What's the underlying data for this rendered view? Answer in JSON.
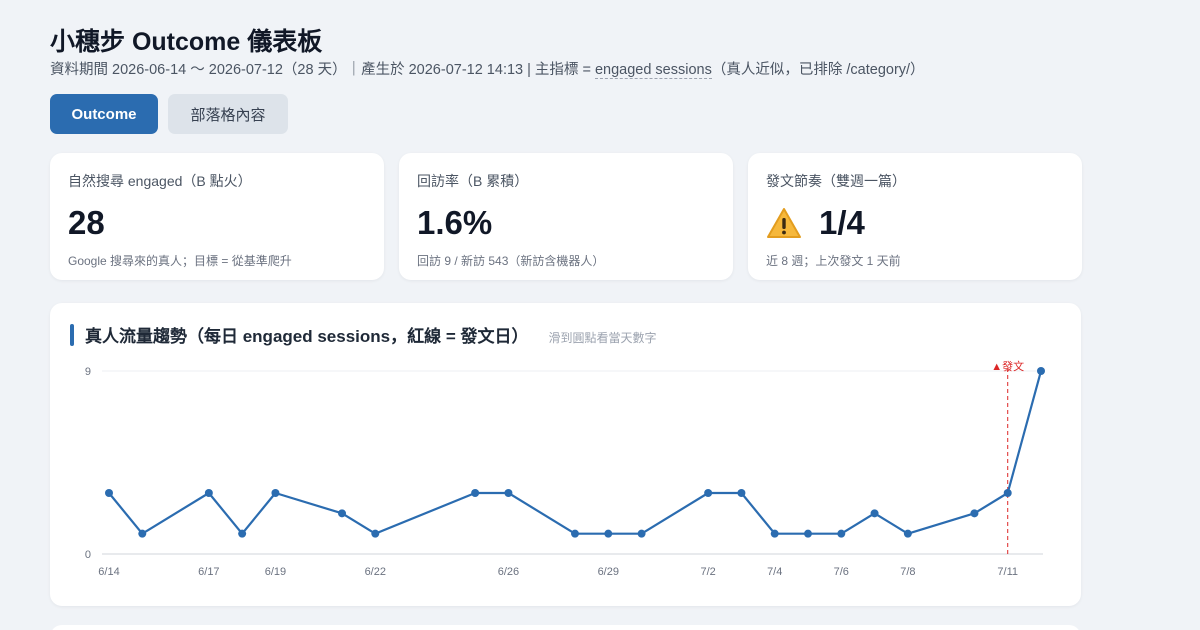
{
  "header": {
    "title": "小穗步 Outcome 儀表板",
    "subtitle_prefix": "資料期間 2026-06-14 ～ 2026-07-12（28 天）｜產生於 2026-07-12 14:13 | 主指標 = ",
    "subtitle_metric": "engaged sessions",
    "subtitle_suffix": "（真人近似，已排除 /category/）"
  },
  "tabs": [
    {
      "label": "Outcome",
      "active": true
    },
    {
      "label": "部落格內容",
      "active": false
    }
  ],
  "kpis": [
    {
      "label": "自然搜尋 engaged（B 點火）",
      "value": "28",
      "note": "Google 搜尋來的真人；目標 = 從基準爬升",
      "icon": null
    },
    {
      "label": "回訪率（B 累積）",
      "value": "1.6%",
      "note": "回訪 9 / 新訪 543（新訪含機器人）",
      "icon": null
    },
    {
      "label": "發文節奏（雙週一篇）",
      "value": "1/4",
      "note": "近 8 週；上次發文 1 天前",
      "icon": "warning-icon"
    }
  ],
  "chart": {
    "title": "真人流量趨勢（每日 engaged sessions，紅線 = 發文日）",
    "hint": "滑到圓點看當天數字"
  },
  "chart_data": {
    "type": "line",
    "title": "真人流量趨勢（每日 engaged sessions，紅線 = 發文日）",
    "x": [
      "6/14",
      "6/15",
      "6/17",
      "6/18",
      "6/19",
      "6/21",
      "6/22",
      "6/25",
      "6/26",
      "6/28",
      "6/29",
      "6/30",
      "7/2",
      "7/3",
      "7/4",
      "7/5",
      "7/6",
      "7/7",
      "7/8",
      "7/10",
      "7/11",
      "7/12"
    ],
    "y": [
      3,
      1,
      3,
      1,
      3,
      2,
      1,
      3,
      3,
      1,
      1,
      1,
      3,
      3,
      1,
      1,
      1,
      2,
      1,
      2,
      3,
      9
    ],
    "tick_labels": [
      "6/14",
      "6/17",
      "6/19",
      "6/22",
      "6/26",
      "6/29",
      "7/2",
      "7/4",
      "7/6",
      "7/8",
      "7/11"
    ],
    "y_ticks": [
      0,
      9
    ],
    "ylim": [
      0,
      9
    ],
    "grid": true,
    "series_color": "#2b6cb0",
    "annotations": [
      {
        "x": "7/11",
        "label": "▲發文",
        "color": "#dc2626"
      }
    ]
  }
}
